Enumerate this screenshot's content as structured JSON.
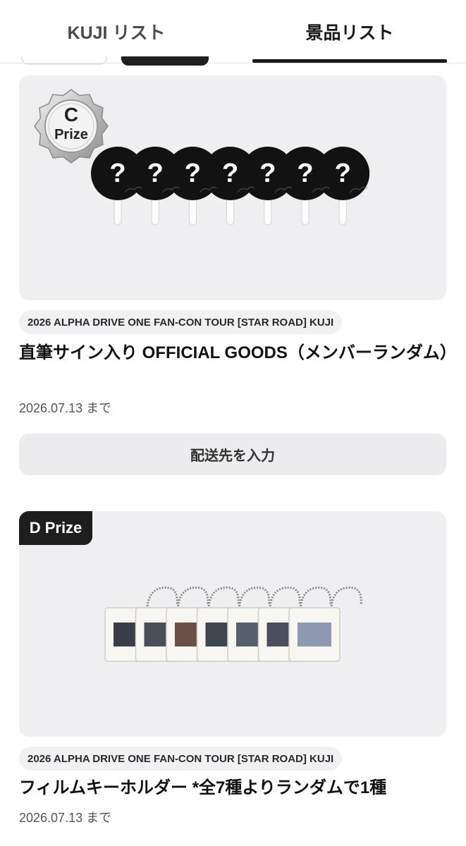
{
  "tabs": {
    "kuji_list": "KUJI リスト",
    "prize_list": "景品リスト",
    "active": "prize_list"
  },
  "prizes": [
    {
      "badge_letter": "C",
      "badge_word": "Prize",
      "tag": "2026 ALPHA DRIVE ONE FAN-CON TOUR [STAR ROAD] KUJI",
      "title": "直筆サイン入り OFFICIAL GOODS（メンバーランダム）",
      "deadline": "2026.07.13 まで",
      "cta": "配送先を入力",
      "item_count": 7,
      "item_mark": "?"
    },
    {
      "badge": "D Prize",
      "tag": "2026 ALPHA DRIVE ONE FAN-CON TOUR [STAR ROAD] KUJI",
      "title": "フィルムキーホルダー *全7種よりランダムで1種",
      "deadline": "2026.07.13 まで",
      "item_count": 7
    }
  ]
}
